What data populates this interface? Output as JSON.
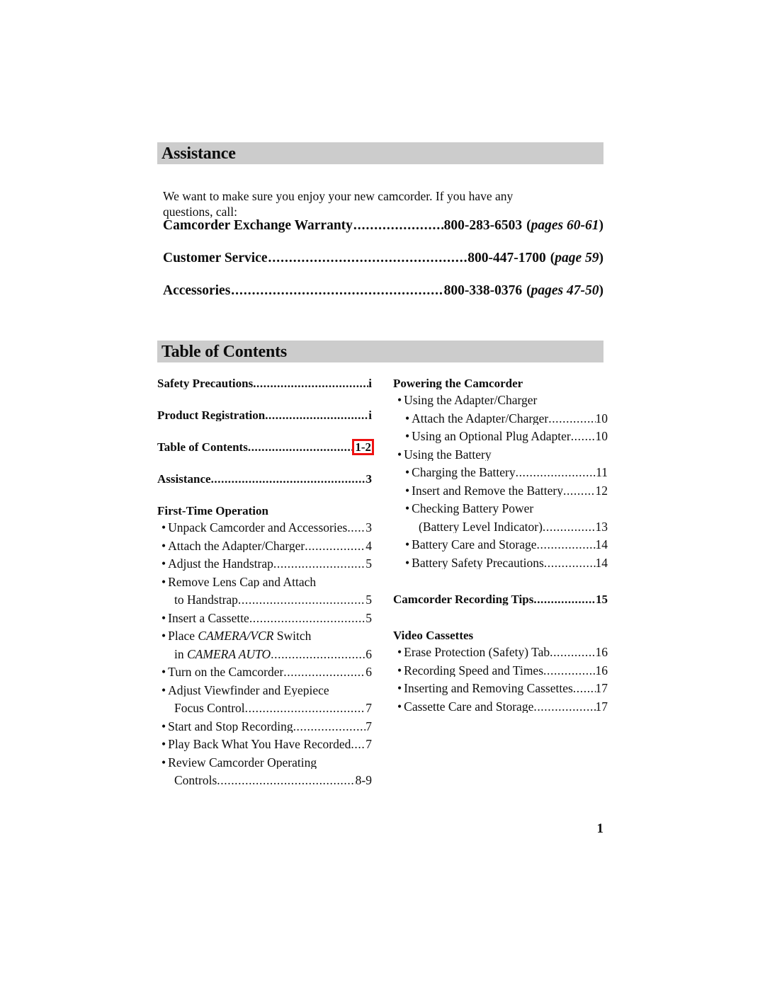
{
  "document": {
    "folio": "1"
  },
  "assistance": {
    "heading": "Assistance",
    "intro": "We want to make sure you enjoy your new camcorder. If you have any questions, call:",
    "rows": [
      {
        "label": "Camcorder Exchange Warranty",
        "dots": "..........................................................................",
        "number": "800-283-6503",
        "pages_open": "(",
        "pages_italic": "pages 60-61",
        "pages_close": ")"
      },
      {
        "label": "Customer Service",
        "dots": "..........................................................................",
        "number": "800-447-1700",
        "pages_open": "(",
        "pages_italic": "page 59",
        "pages_close": ")"
      },
      {
        "label": "Accessories",
        "dots": "..........................................................................",
        "number": "800-338-0376",
        "pages_open": "(",
        "pages_italic": "pages 47-50",
        "pages_close": ")"
      }
    ]
  },
  "toc": {
    "heading": "Table of Contents",
    "dots": "................................................................................................",
    "left_column": [
      {
        "kind": "head",
        "text": "Safety Precautions",
        "page": "i"
      },
      {
        "kind": "gap-md"
      },
      {
        "kind": "head",
        "text": "Product Registration",
        "page": "i"
      },
      {
        "kind": "gap-md"
      },
      {
        "kind": "head",
        "text": "Table of Contents",
        "page": "1-2",
        "highlight": true
      },
      {
        "kind": "gap-md"
      },
      {
        "kind": "head",
        "text": "Assistance",
        "page": "3"
      },
      {
        "kind": "gap-md"
      },
      {
        "kind": "group",
        "text": "First-Time Operation"
      },
      {
        "kind": "bullet1",
        "text": "Unpack Camcorder and Accessories",
        "page": "3"
      },
      {
        "kind": "bullet1",
        "text": "Attach the Adapter/Charger",
        "page": "4"
      },
      {
        "kind": "bullet1",
        "text": "Adjust the Handstrap",
        "page": "5"
      },
      {
        "kind": "bullet1-nodots",
        "text": "Remove Lens Cap and Attach"
      },
      {
        "kind": "cont1",
        "text": "to Handstrap",
        "page": "5"
      },
      {
        "kind": "bullet1",
        "text": "Insert a Cassette",
        "page": "5"
      },
      {
        "kind": "bullet1-italic-nodots",
        "pre": "Place ",
        "italic": "CAMERA/VCR",
        "post": " Switch"
      },
      {
        "kind": "cont1-italic",
        "pre": "in ",
        "italic": "CAMERA AUTO",
        "post": "",
        "page": "6"
      },
      {
        "kind": "bullet1",
        "text": "Turn on the Camcorder",
        "page": "6"
      },
      {
        "kind": "bullet1-nodots",
        "text": "Adjust Viewfinder and Eyepiece"
      },
      {
        "kind": "cont1",
        "text": "Focus Control",
        "page": "7"
      },
      {
        "kind": "bullet1",
        "text": "Start and Stop Recording",
        "page": "7"
      },
      {
        "kind": "bullet1",
        "text": "Play Back What You Have Recorded",
        "page": "7"
      },
      {
        "kind": "bullet1-nodots",
        "text": "Review Camcorder Operating"
      },
      {
        "kind": "cont1",
        "text": "Controls",
        "page": "8-9"
      }
    ],
    "right_column": [
      {
        "kind": "group",
        "text": "Powering the Camcorder"
      },
      {
        "kind": "bullet1-nodots",
        "text": "Using the Adapter/Charger"
      },
      {
        "kind": "bullet2",
        "text": "Attach the Adapter/Charger",
        "page": "10"
      },
      {
        "kind": "bullet2",
        "text": "Using an Optional Plug Adapter",
        "page": "10"
      },
      {
        "kind": "bullet1-nodots",
        "text": "Using the Battery"
      },
      {
        "kind": "bullet2",
        "text": "Charging the Battery",
        "page": "11"
      },
      {
        "kind": "bullet2",
        "text": "Insert and Remove the Battery",
        "page": "12"
      },
      {
        "kind": "bullet2-nodots",
        "text": "Checking Battery Power"
      },
      {
        "kind": "cont2",
        "text": "(Battery Level Indicator)",
        "page": "13"
      },
      {
        "kind": "bullet2",
        "text": "Battery Care and Storage",
        "page": "14"
      },
      {
        "kind": "bullet2",
        "text": "Battery Safety Precautions",
        "page": "14"
      },
      {
        "kind": "gap-lg"
      },
      {
        "kind": "head",
        "text": "Camcorder Recording Tips",
        "page": "15"
      },
      {
        "kind": "gap-lg"
      },
      {
        "kind": "group",
        "text": "Video Cassettes"
      },
      {
        "kind": "bullet1",
        "text": "Erase Protection (Safety) Tab",
        "page": "16"
      },
      {
        "kind": "bullet1",
        "text": "Recording Speed and Times",
        "page": "16"
      },
      {
        "kind": "bullet1",
        "text": "Inserting and Removing Cassettes",
        "page": "17"
      },
      {
        "kind": "bullet1",
        "text": "Cassette Care and Storage",
        "page": "17"
      }
    ],
    "bullet_glyph": "•"
  },
  "colors": {
    "header_bar": "#cccccc",
    "highlight": "#ee1111",
    "text": "#0d0d0d"
  }
}
